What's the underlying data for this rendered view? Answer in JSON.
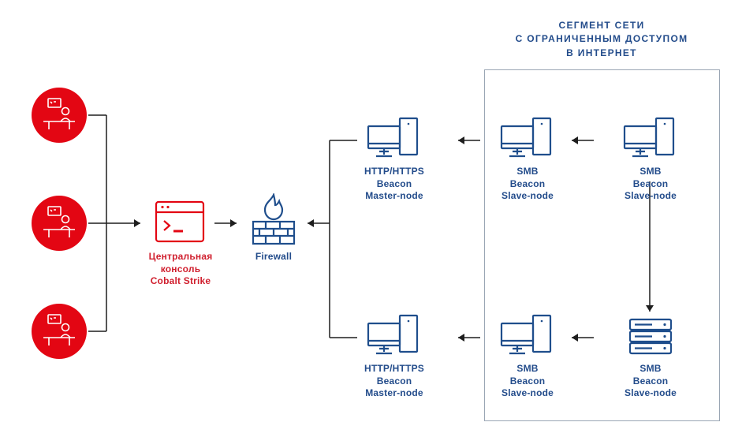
{
  "segment_title_line1": "СЕГМЕНТ СЕТИ",
  "segment_title_line2": "С ОГРАНИЧЕННЫМ ДОСТУПОМ",
  "segment_title_line3": "В ИНТЕРНЕТ",
  "nodes": {
    "console_l1": "Центральная",
    "console_l2": "консоль",
    "console_l3": "Cobalt Strike",
    "firewall": "Firewall",
    "master_l1": "HTTP/HTTPS",
    "master_l2": "Beacon",
    "master_l3": "Master-node",
    "smb_l1": "SMB",
    "smb_l2": "Beacon",
    "smb_l3": "Slave-node"
  },
  "colors": {
    "red": "#E30613",
    "navy": "#1F4E8C",
    "grey_box": "#9AA6B4"
  }
}
